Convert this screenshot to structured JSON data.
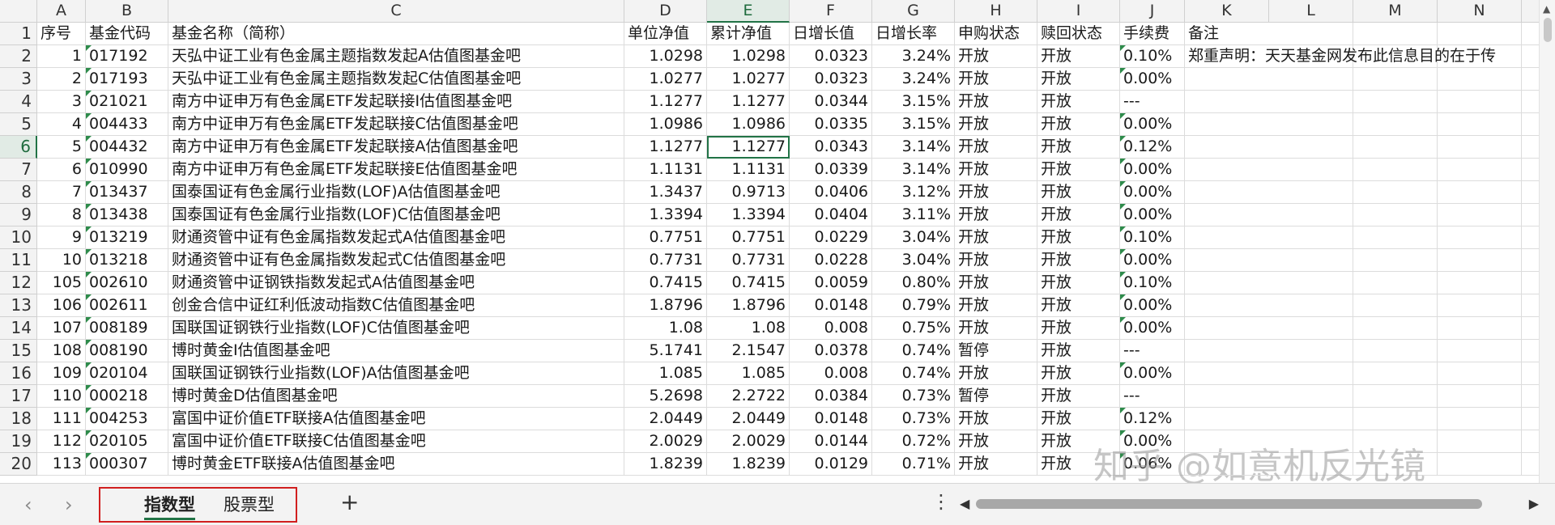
{
  "columns": [
    "",
    "A",
    "B",
    "C",
    "D",
    "E",
    "F",
    "G",
    "H",
    "I",
    "J",
    "K",
    "L",
    "M",
    "N",
    ""
  ],
  "selected_col_index": 5,
  "selected_row_index": 6,
  "header_row": [
    "序号",
    "基金代码",
    "基金名称（简称）",
    "单位净值",
    "累计净值",
    "日增长值",
    "日增长率",
    "申购状态",
    "赎回状态",
    "手续费",
    "备注"
  ],
  "rows": [
    {
      "n": "2",
      "seq": "1",
      "code": "017192",
      "name": "天弘中证工业有色金属主题指数发起A估值图基金吧",
      "nav": "1.0298",
      "acc": "1.0298",
      "dval": "0.0323",
      "drate": "3.24%",
      "buy": "开放",
      "sell": "开放",
      "fee": "0.10%",
      "note": "郑重声明：天天基金网发布此信息目的在于传"
    },
    {
      "n": "3",
      "seq": "2",
      "code": "017193",
      "name": "天弘中证工业有色金属主题指数发起C估值图基金吧",
      "nav": "1.0277",
      "acc": "1.0277",
      "dval": "0.0323",
      "drate": "3.24%",
      "buy": "开放",
      "sell": "开放",
      "fee": "0.00%",
      "note": ""
    },
    {
      "n": "4",
      "seq": "3",
      "code": "021021",
      "name": "南方中证申万有色金属ETF发起联接I估值图基金吧",
      "nav": "1.1277",
      "acc": "1.1277",
      "dval": "0.0344",
      "drate": "3.15%",
      "buy": "开放",
      "sell": "开放",
      "fee": "---",
      "note": ""
    },
    {
      "n": "5",
      "seq": "4",
      "code": "004433",
      "name": "南方中证申万有色金属ETF发起联接C估值图基金吧",
      "nav": "1.0986",
      "acc": "1.0986",
      "dval": "0.0335",
      "drate": "3.15%",
      "buy": "开放",
      "sell": "开放",
      "fee": "0.00%",
      "note": ""
    },
    {
      "n": "6",
      "seq": "5",
      "code": "004432",
      "name": "南方中证申万有色金属ETF发起联接A估值图基金吧",
      "nav": "1.1277",
      "acc": "1.1277",
      "dval": "0.0343",
      "drate": "3.14%",
      "buy": "开放",
      "sell": "开放",
      "fee": "0.12%",
      "note": ""
    },
    {
      "n": "7",
      "seq": "6",
      "code": "010990",
      "name": "南方中证申万有色金属ETF发起联接E估值图基金吧",
      "nav": "1.1131",
      "acc": "1.1131",
      "dval": "0.0339",
      "drate": "3.14%",
      "buy": "开放",
      "sell": "开放",
      "fee": "0.00%",
      "note": ""
    },
    {
      "n": "8",
      "seq": "7",
      "code": "013437",
      "name": "国泰国证有色金属行业指数(LOF)A估值图基金吧",
      "nav": "1.3437",
      "acc": "0.9713",
      "dval": "0.0406",
      "drate": "3.12%",
      "buy": "开放",
      "sell": "开放",
      "fee": "0.00%",
      "note": ""
    },
    {
      "n": "9",
      "seq": "8",
      "code": "013438",
      "name": "国泰国证有色金属行业指数(LOF)C估值图基金吧",
      "nav": "1.3394",
      "acc": "1.3394",
      "dval": "0.0404",
      "drate": "3.11%",
      "buy": "开放",
      "sell": "开放",
      "fee": "0.00%",
      "note": ""
    },
    {
      "n": "10",
      "seq": "9",
      "code": "013219",
      "name": "财通资管中证有色金属指数发起式A估值图基金吧",
      "nav": "0.7751",
      "acc": "0.7751",
      "dval": "0.0229",
      "drate": "3.04%",
      "buy": "开放",
      "sell": "开放",
      "fee": "0.10%",
      "note": ""
    },
    {
      "n": "11",
      "seq": "10",
      "code": "013218",
      "name": "财通资管中证有色金属指数发起式C估值图基金吧",
      "nav": "0.7731",
      "acc": "0.7731",
      "dval": "0.0228",
      "drate": "3.04%",
      "buy": "开放",
      "sell": "开放",
      "fee": "0.00%",
      "note": ""
    },
    {
      "n": "12",
      "seq": "105",
      "code": "002610",
      "name": "财通资管中证钢铁指数发起式A估值图基金吧",
      "nav": "0.7415",
      "acc": "0.7415",
      "dval": "0.0059",
      "drate": "0.80%",
      "buy": "开放",
      "sell": "开放",
      "fee": "0.10%",
      "note": ""
    },
    {
      "n": "13",
      "seq": "106",
      "code": "002611",
      "name": "创金合信中证红利低波动指数C估值图基金吧",
      "nav": "1.8796",
      "acc": "1.8796",
      "dval": "0.0148",
      "drate": "0.79%",
      "buy": "开放",
      "sell": "开放",
      "fee": "0.00%",
      "note": ""
    },
    {
      "n": "14",
      "seq": "107",
      "code": "008189",
      "name": "国联国证钢铁行业指数(LOF)C估值图基金吧",
      "nav": "1.08",
      "acc": "1.08",
      "dval": "0.008",
      "drate": "0.75%",
      "buy": "开放",
      "sell": "开放",
      "fee": "0.00%",
      "note": ""
    },
    {
      "n": "15",
      "seq": "108",
      "code": "008190",
      "name": "博时黄金I估值图基金吧",
      "nav": "5.1741",
      "acc": "2.1547",
      "dval": "0.0378",
      "drate": "0.74%",
      "buy": "暂停",
      "sell": "开放",
      "fee": "---",
      "note": ""
    },
    {
      "n": "16",
      "seq": "109",
      "code": "020104",
      "name": "国联国证钢铁行业指数(LOF)A估值图基金吧",
      "nav": "1.085",
      "acc": "1.085",
      "dval": "0.008",
      "drate": "0.74%",
      "buy": "开放",
      "sell": "开放",
      "fee": "0.00%",
      "note": ""
    },
    {
      "n": "17",
      "seq": "110",
      "code": "000218",
      "name": "博时黄金D估值图基金吧",
      "nav": "5.2698",
      "acc": "2.2722",
      "dval": "0.0384",
      "drate": "0.73%",
      "buy": "暂停",
      "sell": "开放",
      "fee": "---",
      "note": ""
    },
    {
      "n": "18",
      "seq": "111",
      "code": "004253",
      "name": "富国中证价值ETF联接A估值图基金吧",
      "nav": "2.0449",
      "acc": "2.0449",
      "dval": "0.0148",
      "drate": "0.73%",
      "buy": "开放",
      "sell": "开放",
      "fee": "0.12%",
      "note": ""
    },
    {
      "n": "19",
      "seq": "112",
      "code": "020105",
      "name": "富国中证价值ETF联接C估值图基金吧",
      "nav": "2.0029",
      "acc": "2.0029",
      "dval": "0.0144",
      "drate": "0.72%",
      "buy": "开放",
      "sell": "开放",
      "fee": "0.00%",
      "note": ""
    },
    {
      "n": "20",
      "seq": "113",
      "code": "000307",
      "name": "博时黄金ETF联接A估值图基金吧",
      "nav": "1.8239",
      "acc": "1.8239",
      "dval": "0.0129",
      "drate": "0.71%",
      "buy": "开放",
      "sell": "开放",
      "fee": "0.06%",
      "note": ""
    }
  ],
  "sheet_tabs": [
    "指数型",
    "股票型"
  ],
  "active_tab_index": 0,
  "add_sheet_label": "+",
  "watermark": "知乎 @如意机反光镜",
  "colors": {
    "accent": "#217346",
    "highlight_box": "#d11f1f"
  }
}
